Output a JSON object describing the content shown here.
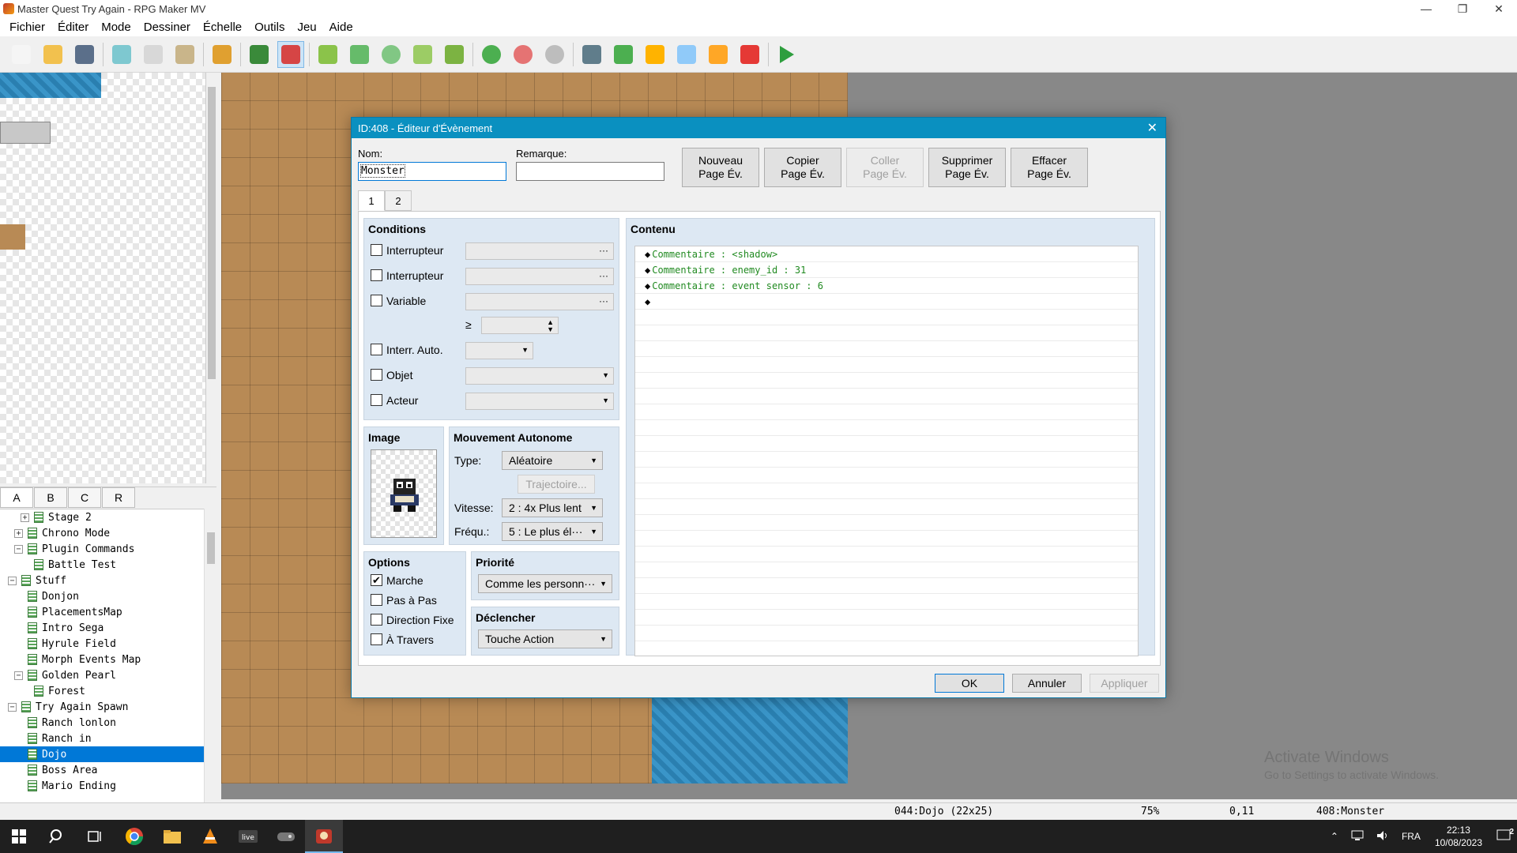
{
  "window": {
    "title": "Master Quest Try Again - RPG Maker MV",
    "controls": [
      "—",
      "❐",
      "✕"
    ]
  },
  "menu": [
    "Fichier",
    "Éditer",
    "Mode",
    "Dessiner",
    "Échelle",
    "Outils",
    "Jeu",
    "Aide"
  ],
  "toolbar": [
    {
      "name": "new-project-icon",
      "color": "#f5f5f5"
    },
    {
      "name": "open-project-icon",
      "color": "#f2c14e"
    },
    {
      "name": "save-project-icon",
      "color": "#5b6f8a"
    },
    {
      "name": "cut-icon",
      "color": "#7ec8d0"
    },
    {
      "name": "copy-icon",
      "color": "#d8d8d8"
    },
    {
      "name": "paste-icon",
      "color": "#c9b58a"
    },
    {
      "name": "undo-icon",
      "color": "#e0a030"
    },
    {
      "name": "map-mode-icon",
      "color": "#3a8a3a"
    },
    {
      "name": "event-mode-icon",
      "color": "#d64545"
    },
    {
      "name": "pencil-icon",
      "color": "#8bc34a"
    },
    {
      "name": "rectangle-icon",
      "color": "#66bb6a"
    },
    {
      "name": "ellipse-icon",
      "color": "#81c784"
    },
    {
      "name": "fill-icon",
      "color": "#9ccc65"
    },
    {
      "name": "shadow-pen-icon",
      "color": "#7cb342"
    },
    {
      "name": "zoom-in-icon",
      "color": "#4caf50"
    },
    {
      "name": "zoom-out-icon",
      "color": "#e57373"
    },
    {
      "name": "zoom-actual-icon",
      "color": "#bdbdbd"
    },
    {
      "name": "database-icon",
      "color": "#607d8b"
    },
    {
      "name": "plugin-manager-icon",
      "color": "#4caf50"
    },
    {
      "name": "sound-test-icon",
      "color": "#ffb300"
    },
    {
      "name": "event-searcher-icon",
      "color": "#90caf9"
    },
    {
      "name": "resource-manager-icon",
      "color": "#ffa726"
    },
    {
      "name": "character-generator-icon",
      "color": "#e53935"
    },
    {
      "name": "playtest-icon",
      "color": "#2e9e3e"
    }
  ],
  "tile_tabs": [
    "A",
    "B",
    "C",
    "R"
  ],
  "map_tree": [
    {
      "label": "Stage 2",
      "indent": 2,
      "expander": "+",
      "selected": false
    },
    {
      "label": "Chrono Mode",
      "indent": 1,
      "expander": "+",
      "selected": false
    },
    {
      "label": "Plugin Commands",
      "indent": 1,
      "expander": "−",
      "selected": false
    },
    {
      "label": "Battle Test",
      "indent": 2,
      "expander": "",
      "selected": false
    },
    {
      "label": "Stuff",
      "indent": 0,
      "expander": "−",
      "selected": false
    },
    {
      "label": "Donjon",
      "indent": 1,
      "expander": "",
      "selected": false
    },
    {
      "label": "PlacementsMap",
      "indent": 1,
      "expander": "",
      "selected": false
    },
    {
      "label": "Intro Sega",
      "indent": 1,
      "expander": "",
      "selected": false
    },
    {
      "label": "Hyrule Field",
      "indent": 1,
      "expander": "",
      "selected": false
    },
    {
      "label": "Morph Events Map",
      "indent": 1,
      "expander": "",
      "selected": false
    },
    {
      "label": "Golden Pearl",
      "indent": 1,
      "expander": "−",
      "selected": false
    },
    {
      "label": "Forest",
      "indent": 2,
      "expander": "",
      "selected": false
    },
    {
      "label": "Try Again Spawn",
      "indent": 0,
      "expander": "−",
      "selected": false
    },
    {
      "label": "Ranch lonlon",
      "indent": 1,
      "expander": "",
      "selected": false
    },
    {
      "label": "Ranch in",
      "indent": 1,
      "expander": "",
      "selected": false
    },
    {
      "label": "Dojo",
      "indent": 1,
      "expander": "",
      "selected": true
    },
    {
      "label": "Boss Area",
      "indent": 1,
      "expander": "",
      "selected": false
    },
    {
      "label": "Mario Ending",
      "indent": 1,
      "expander": "",
      "selected": false
    }
  ],
  "status": {
    "map": "044:Dojo (22x25)",
    "zoom": "75%",
    "coords": "0,11",
    "event": "408:Monster"
  },
  "watermark": {
    "line1": "Activate Windows",
    "line2": "Go to Settings to activate Windows."
  },
  "taskbar": {
    "lang": "FRA",
    "time": "22:13",
    "date": "10/08/2023",
    "notif": "2"
  },
  "dialog": {
    "title": "ID:408 - Éditeur d'Évènement",
    "name_label": "Nom:",
    "name_value": "Monster",
    "note_label": "Remarque:",
    "note_value": "",
    "buttons": {
      "new_page": [
        "Nouveau",
        "Page Év."
      ],
      "copy_page": [
        "Copier",
        "Page Év."
      ],
      "paste_page": [
        "Coller",
        "Page Év."
      ],
      "delete_page": [
        "Supprimer",
        "Page Év."
      ],
      "clear_page": [
        "Effacer",
        "Page Év."
      ]
    },
    "page_tabs": [
      "1",
      "2"
    ],
    "conditions": {
      "title": "Conditions",
      "switch1": "Interrupteur",
      "switch2": "Interrupteur",
      "variable": "Variable",
      "gte": "≥",
      "self_switch": "Interr. Auto.",
      "item": "Objet",
      "actor": "Acteur",
      "dots": "···"
    },
    "image": {
      "title": "Image"
    },
    "movement": {
      "title": "Mouvement Autonome",
      "type_label": "Type:",
      "type_value": "Aléatoire",
      "route_button": "Trajectoire...",
      "speed_label": "Vitesse:",
      "speed_value": "2 : 4x Plus lent",
      "freq_label": "Fréqu.:",
      "freq_value": "5 : Le plus él···"
    },
    "options": {
      "title": "Options",
      "walking": "Marche",
      "stepping": "Pas à Pas",
      "direction_fix": "Direction Fixe",
      "through": "À Travers",
      "walking_checked": "✔"
    },
    "priority": {
      "title": "Priorité",
      "value": "Comme les personn···"
    },
    "trigger": {
      "title": "Déclencher",
      "value": "Touche Action"
    },
    "contents": {
      "title": "Contenu",
      "commands": [
        "Commentaire : <shadow>",
        "Commentaire : enemy_id : 31",
        "Commentaire : event sensor : 6",
        ""
      ]
    },
    "ok": "OK",
    "cancel": "Annuler",
    "apply": "Appliquer"
  }
}
